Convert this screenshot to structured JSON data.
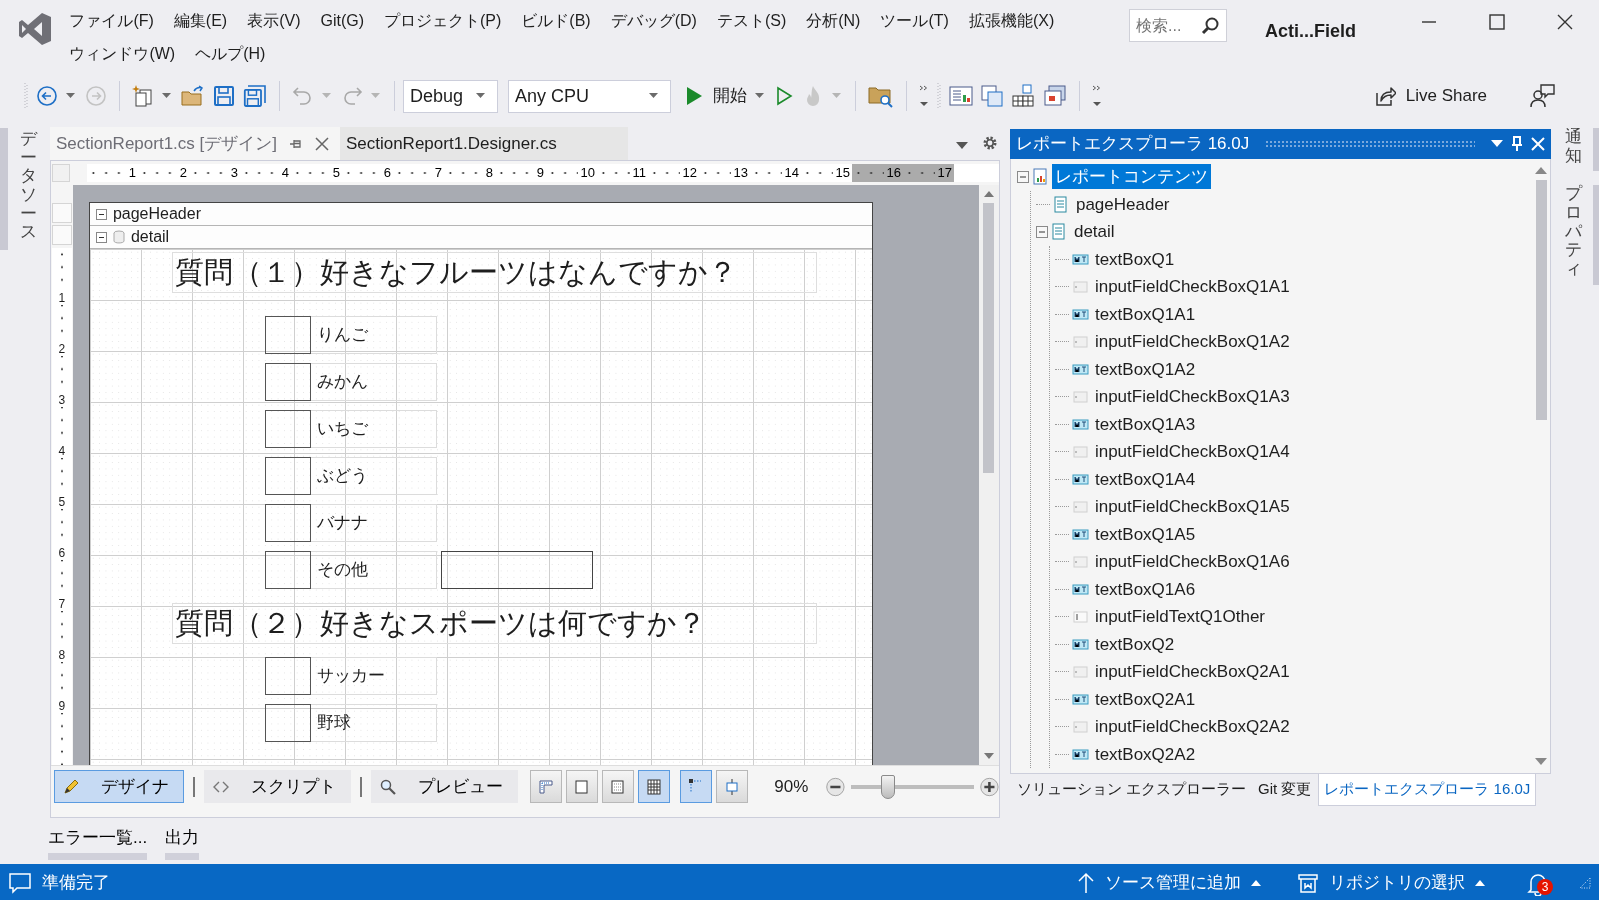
{
  "window": {
    "title": "Acti...Field",
    "search_placeholder": "検索..."
  },
  "menu": [
    "ファイル(F)",
    "編集(E)",
    "表示(V)",
    "Git(G)",
    "プロジェクト(P)",
    "ビルド(B)",
    "デバッグ(D)",
    "テスト(S)",
    "分析(N)",
    "ツール(T)",
    "拡張機能(X)",
    "ウィンドウ(W)",
    "ヘルプ(H)"
  ],
  "toolbar": {
    "configuration": "Debug",
    "platform": "Any CPU",
    "start": "開始",
    "live_share": "Live Share"
  },
  "left_tabs": [
    "データソース"
  ],
  "doc_tabs": [
    {
      "label": "SectionReport1.cs [デザイン]",
      "selected": true
    },
    {
      "label": "SectionReport1.Designer.cs",
      "selected": false
    }
  ],
  "ruler": {
    "horizontal": [
      "1",
      "2",
      "3",
      "4",
      "5",
      "6",
      "7",
      "8",
      "9",
      "10",
      "11",
      "12",
      "13",
      "14",
      "15",
      "16",
      "17"
    ],
    "vertical": [
      "1",
      "2",
      "3",
      "4",
      "5",
      "6",
      "7",
      "8",
      "9"
    ]
  },
  "sections": [
    {
      "label": "pageHeader",
      "kind": "header"
    },
    {
      "label": "detail",
      "kind": "detail"
    }
  ],
  "questions": [
    {
      "title": "質問（１）好きなフルーツはなんですか？",
      "options": [
        {
          "label": "りんご",
          "kind": "option",
          "checked": false
        },
        {
          "label": "みかん",
          "kind": "option",
          "checked": false
        },
        {
          "label": "いちご",
          "kind": "option",
          "checked": false
        },
        {
          "label": "ぶどう",
          "kind": "option",
          "checked": false
        },
        {
          "label": "バナナ",
          "kind": "option",
          "checked": false
        },
        {
          "label": "その他",
          "kind": "other",
          "checked": false
        }
      ]
    },
    {
      "title": "質問（２）好きなスポーツは何ですか？",
      "options": [
        {
          "label": "サッカー",
          "kind": "option",
          "checked": false
        },
        {
          "label": "野球",
          "kind": "option",
          "checked": false
        }
      ]
    }
  ],
  "view_tabs": [
    {
      "label": "デザイナ",
      "kind": "design",
      "selected": true
    },
    {
      "label": "スクリプト",
      "kind": "script",
      "selected": false
    },
    {
      "label": "プレビュー",
      "kind": "preview",
      "selected": false
    }
  ],
  "layout_tools": [
    {
      "kind": "ruler",
      "selected": false
    },
    {
      "kind": "box",
      "selected": false
    },
    {
      "kind": "dots",
      "selected": false
    },
    {
      "kind": "grid",
      "selected": true
    },
    {
      "kind": "snap",
      "selected": true
    },
    {
      "kind": "align",
      "selected": false
    }
  ],
  "zoom": {
    "reading": "90%",
    "level": 0.3
  },
  "explorer": {
    "title": "レポートエクスプローラ 16.0J",
    "tree": [
      {
        "label": "レポートコンテンツ",
        "kind": "report",
        "selected": true,
        "expanded": true,
        "children": [
          {
            "label": "pageHeader",
            "kind": "section",
            "selected": false
          },
          {
            "label": "detail",
            "kind": "section",
            "selected": false,
            "expanded": true,
            "children": [
              {
                "label": "textBoxQ1",
                "kind": "textbox",
                "selected": false
              },
              {
                "label": "inputFieldCheckBoxQ1A1",
                "kind": "checkbox",
                "selected": false
              },
              {
                "label": "textBoxQ1A1",
                "kind": "textbox",
                "selected": false
              },
              {
                "label": "inputFieldCheckBoxQ1A2",
                "kind": "checkbox",
                "selected": false
              },
              {
                "label": "textBoxQ1A2",
                "kind": "textbox",
                "selected": false
              },
              {
                "label": "inputFieldCheckBoxQ1A3",
                "kind": "checkbox",
                "selected": false
              },
              {
                "label": "textBoxQ1A3",
                "kind": "textbox",
                "selected": false
              },
              {
                "label": "inputFieldCheckBoxQ1A4",
                "kind": "checkbox",
                "selected": false
              },
              {
                "label": "textBoxQ1A4",
                "kind": "textbox",
                "selected": false
              },
              {
                "label": "inputFieldCheckBoxQ1A5",
                "kind": "checkbox",
                "selected": false
              },
              {
                "label": "textBoxQ1A5",
                "kind": "textbox",
                "selected": false
              },
              {
                "label": "inputFieldCheckBoxQ1A6",
                "kind": "checkbox",
                "selected": false
              },
              {
                "label": "textBoxQ1A6",
                "kind": "textbox",
                "selected": false
              },
              {
                "label": "inputFieldTextQ1Other",
                "kind": "textfield",
                "selected": false
              },
              {
                "label": "textBoxQ2",
                "kind": "textbox",
                "selected": false
              },
              {
                "label": "inputFieldCheckBoxQ2A1",
                "kind": "checkbox",
                "selected": false
              },
              {
                "label": "textBoxQ2A1",
                "kind": "textbox",
                "selected": false
              },
              {
                "label": "inputFieldCheckBoxQ2A2",
                "kind": "checkbox",
                "selected": false
              },
              {
                "label": "textBoxQ2A2",
                "kind": "textbox",
                "selected": false
              }
            ]
          }
        ]
      }
    ]
  },
  "explorer_tabs": [
    {
      "label": "ソリューション エクスプローラー",
      "selected": false
    },
    {
      "label": "Git 変更",
      "selected": false
    },
    {
      "label": "レポートエクスプローラ 16.0J",
      "selected": true
    }
  ],
  "right_tabs": [
    "通知",
    "プロパティ"
  ],
  "bottom_tabs": [
    "エラー一覧...",
    "出力"
  ],
  "status": {
    "text": "準備完了",
    "source_control": "ソース管理に追加",
    "repository": "リポジトリの選択",
    "notifications": "3"
  }
}
